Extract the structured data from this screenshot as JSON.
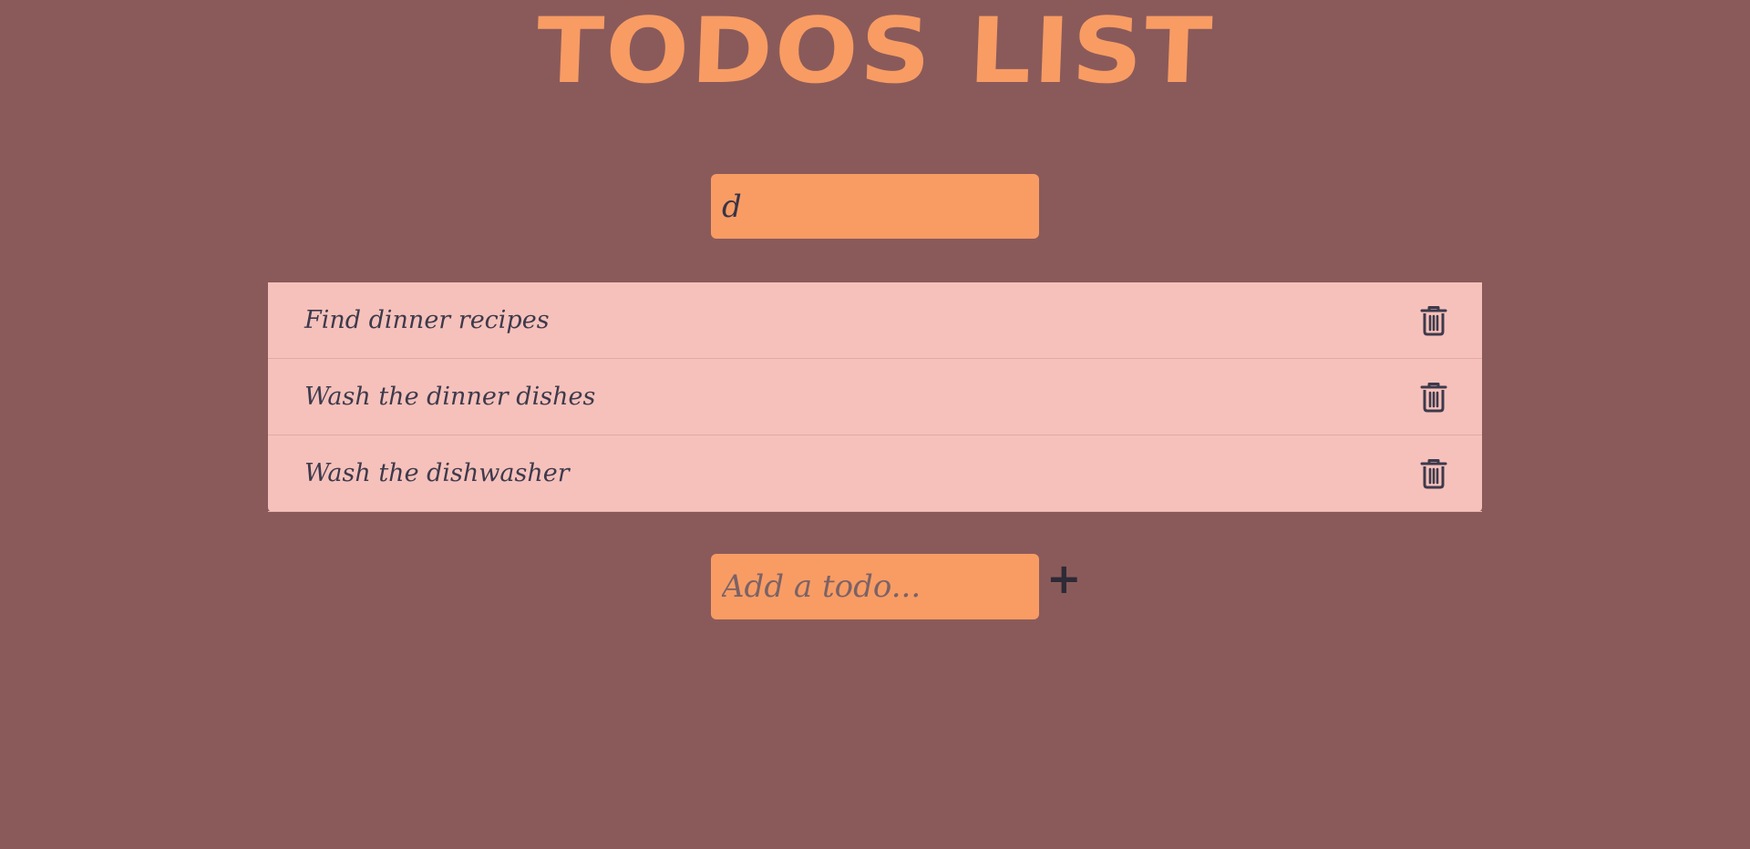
{
  "header": {
    "title": "TODOS LIST"
  },
  "search": {
    "value": "d",
    "placeholder": ""
  },
  "todos": [
    {
      "text": "Find dinner recipes",
      "icon": "trash-icon"
    },
    {
      "text": "Wash the dinner dishes",
      "icon": "trash-icon"
    },
    {
      "text": "Wash the dishwasher",
      "icon": "trash-icon"
    }
  ],
  "add_form": {
    "placeholder": "Add a todo...",
    "value": "",
    "button_label": "+"
  },
  "colors": {
    "background": "#8a5a5a",
    "accent": "#f89c64",
    "list_bg": "#f6c1bb",
    "text": "#3e3a4c"
  }
}
